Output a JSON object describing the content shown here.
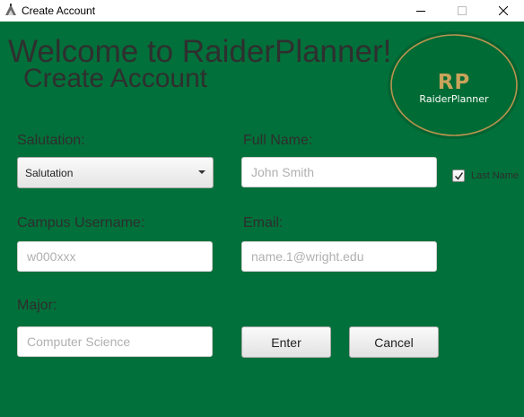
{
  "window": {
    "title": "Create Account",
    "icon": "app-icon"
  },
  "header": {
    "welcome": "Welcome to RaiderPlanner!",
    "subtitle": "Create Account"
  },
  "logo": {
    "monogram": "RP",
    "name": "RaiderPlanner"
  },
  "form": {
    "salutation_label": "Salutation:",
    "salutation_value": "Salutation",
    "full_name_label": "Full Name:",
    "full_name_placeholder": "John Smith",
    "last_name_checkbox_label": "Last Name",
    "last_name_checked": true,
    "campus_username_label": "Campus Username:",
    "campus_username_placeholder": "w000xxx",
    "email_label": "Email:",
    "email_placeholder": "name.1@wright.edu",
    "major_label": "Major:",
    "major_placeholder": "Computer Science"
  },
  "buttons": {
    "enter": "Enter",
    "cancel": "Cancel"
  },
  "colors": {
    "background": "#02703a",
    "logo_gold": "#c9a35a",
    "logo_fill": "#006b34"
  }
}
